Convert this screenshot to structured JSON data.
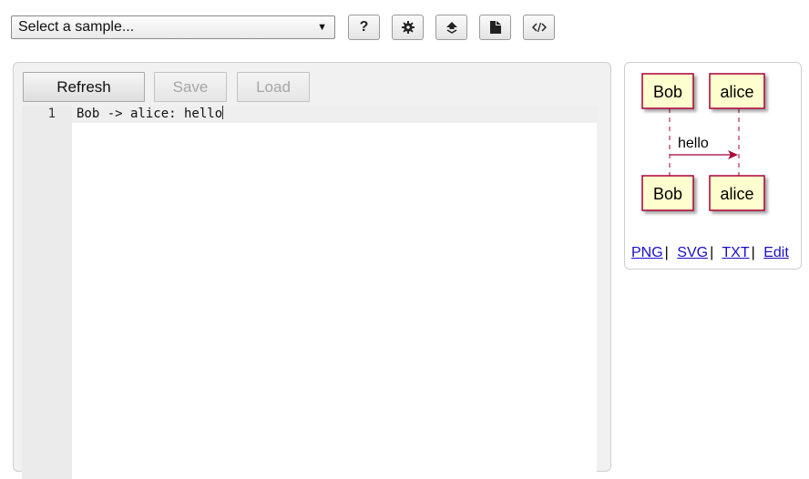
{
  "toolbar": {
    "sample_select": {
      "value": "Select a sample...",
      "arrow": "▼"
    },
    "buttons": [
      {
        "name": "help",
        "icon": "question-icon",
        "label": "?"
      },
      {
        "name": "settings",
        "icon": "gear-icon"
      },
      {
        "name": "upload",
        "icon": "upload-icon"
      },
      {
        "name": "file",
        "icon": "file-icon"
      },
      {
        "name": "code",
        "icon": "code-icon"
      }
    ]
  },
  "editor": {
    "buttons": {
      "refresh": "Refresh",
      "save": "Save",
      "load": "Load"
    },
    "lines": [
      {
        "number": "1",
        "text": "Bob -> alice: hello"
      }
    ]
  },
  "preview": {
    "participants": [
      "Bob",
      "alice"
    ],
    "message": "hello",
    "colors": {
      "participant_fill": "#FEFECE",
      "participant_border": "#A80036",
      "arrow": "#A80036"
    },
    "links": {
      "png": "PNG",
      "svg": "SVG",
      "txt": "TXT",
      "edit": "Edit",
      "separator": "|"
    }
  }
}
